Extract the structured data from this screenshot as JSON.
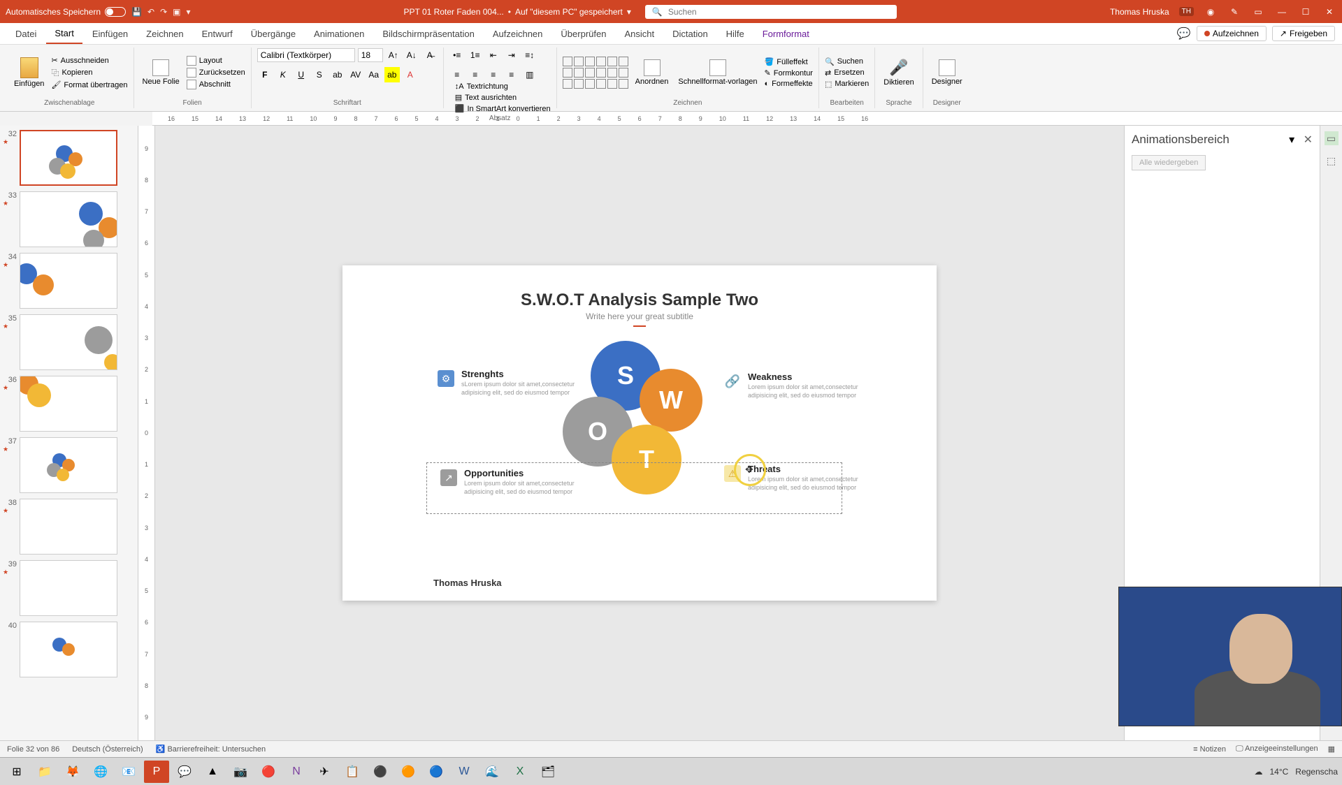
{
  "titlebar": {
    "autosave": "Automatisches Speichern",
    "filename": "PPT 01 Roter Faden 004...",
    "saved_location": "Auf \"diesem PC\" gespeichert",
    "search_placeholder": "Suchen",
    "username": "Thomas Hruska",
    "user_initials": "TH"
  },
  "tabs": {
    "datei": "Datei",
    "start": "Start",
    "einfuegen": "Einfügen",
    "zeichnen": "Zeichnen",
    "entwurf": "Entwurf",
    "uebergaenge": "Übergänge",
    "animationen": "Animationen",
    "bildschirm": "Bildschirmpräsentation",
    "aufzeichnen": "Aufzeichnen",
    "ueberpruefen": "Überprüfen",
    "ansicht": "Ansicht",
    "dictation": "Dictation",
    "hilfe": "Hilfe",
    "formformat": "Formformat",
    "record_btn": "Aufzeichnen",
    "share_btn": "Freigeben"
  },
  "ribbon": {
    "clipboard": {
      "paste": "Einfügen",
      "cut": "Ausschneiden",
      "copy": "Kopieren",
      "format_painter": "Format übertragen",
      "label": "Zwischenablage"
    },
    "slides": {
      "new_slide": "Neue Folie",
      "layout": "Layout",
      "reset": "Zurücksetzen",
      "section": "Abschnitt",
      "label": "Folien"
    },
    "font": {
      "name": "Calibri (Textkörper)",
      "size": "18",
      "label": "Schriftart"
    },
    "paragraph": {
      "text_direction": "Textrichtung",
      "align_text": "Text ausrichten",
      "smartart": "In SmartArt konvertieren",
      "label": "Absatz"
    },
    "drawing": {
      "arrange": "Anordnen",
      "quick_styles": "Schnellformat-vorlagen",
      "fill": "Fülleffekt",
      "outline": "Formkontur",
      "effects": "Formeffekte",
      "label": "Zeichnen"
    },
    "editing": {
      "find": "Suchen",
      "replace": "Ersetzen",
      "select": "Markieren",
      "label": "Bearbeiten"
    },
    "voice": {
      "dictate": "Diktieren",
      "label": "Sprache"
    },
    "designer": {
      "btn": "Designer",
      "label": "Designer"
    }
  },
  "thumbs": [
    {
      "num": "32"
    },
    {
      "num": "33"
    },
    {
      "num": "34"
    },
    {
      "num": "35"
    },
    {
      "num": "36"
    },
    {
      "num": "37"
    },
    {
      "num": "38"
    },
    {
      "num": "39"
    },
    {
      "num": "40"
    }
  ],
  "slide": {
    "title": "S.W.O.T Analysis Sample Two",
    "subtitle": "Write here your great subtitle",
    "s": "S",
    "w": "W",
    "o": "O",
    "t": "T",
    "q1": {
      "title": "Strenghts",
      "body": "sLorem ipsum dolor sit amet,consectetur adipisicing elit, sed do eiusmod tempor"
    },
    "q2": {
      "title": "Weakness",
      "body": "Lorem ipsum dolor sit amet,consectetur adipisicing elit, sed do eiusmod tempor"
    },
    "q3": {
      "title": "Opportunities",
      "body": "Lorem ipsum dolor sit amet,consectetur adipisicing elit, sed do eiusmod tempor"
    },
    "q4": {
      "title": "Threats",
      "body": "Lorem ipsum dolor sit amet,consectetur adipisicing elit, sed do eiusmod tempor"
    },
    "footer": "Thomas Hruska"
  },
  "anim": {
    "title": "Animationsbereich",
    "play_all": "Alle wiedergeben"
  },
  "status": {
    "slide_info": "Folie 32 von 86",
    "language": "Deutsch (Österreich)",
    "accessibility": "Barrierefreiheit: Untersuchen",
    "notes": "Notizen",
    "display": "Anzeigeeinstellungen"
  },
  "taskbar": {
    "temp": "14°C",
    "weather": "Regenscha"
  },
  "ruler_marks": [
    "16",
    "15",
    "14",
    "13",
    "12",
    "11",
    "10",
    "9",
    "8",
    "7",
    "6",
    "5",
    "4",
    "3",
    "2",
    "1",
    "0",
    "1",
    "2",
    "3",
    "4",
    "5",
    "6",
    "7",
    "8",
    "9",
    "10",
    "11",
    "12",
    "13",
    "14",
    "15",
    "16"
  ]
}
